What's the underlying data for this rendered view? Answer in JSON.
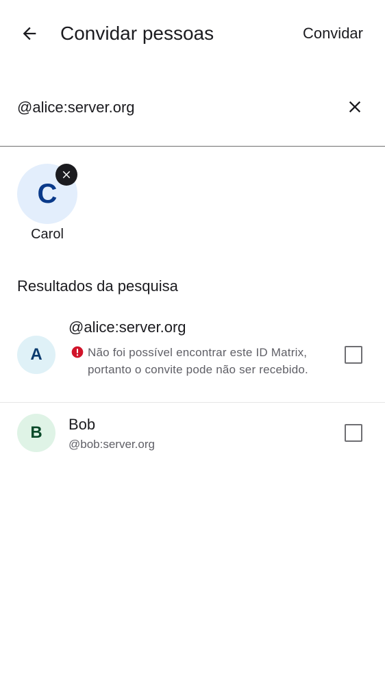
{
  "header": {
    "title": "Convidar pessoas",
    "invite_action": "Convidar"
  },
  "search": {
    "value": "@alice:server.org",
    "placeholder": ""
  },
  "selected_users": [
    {
      "initial": "C",
      "name": "Carol"
    }
  ],
  "results": {
    "section_title": "Resultados da pesquisa",
    "items": [
      {
        "initial": "A",
        "title": "@alice:server.org",
        "warning": "Não foi possível encontrar este ID Matrix, portanto o convite pode não ser recebido.",
        "checked": false
      },
      {
        "initial": "B",
        "title": "Bob",
        "subtitle": "@bob:server.org",
        "checked": false
      }
    ]
  },
  "icons": {
    "back": "arrow-back-icon",
    "clear": "close-icon",
    "remove_selected": "close-icon",
    "warning": "error-icon"
  },
  "colors": {
    "selected_avatar_bg": "#e3eefc",
    "selected_avatar_fg": "#0a3a8a",
    "alice_avatar_bg": "#dff1f7",
    "alice_avatar_fg": "#0b3b6e",
    "bob_avatar_bg": "#dff3e6",
    "bob_avatar_fg": "#0b4a2a",
    "error": "#d1142a"
  }
}
